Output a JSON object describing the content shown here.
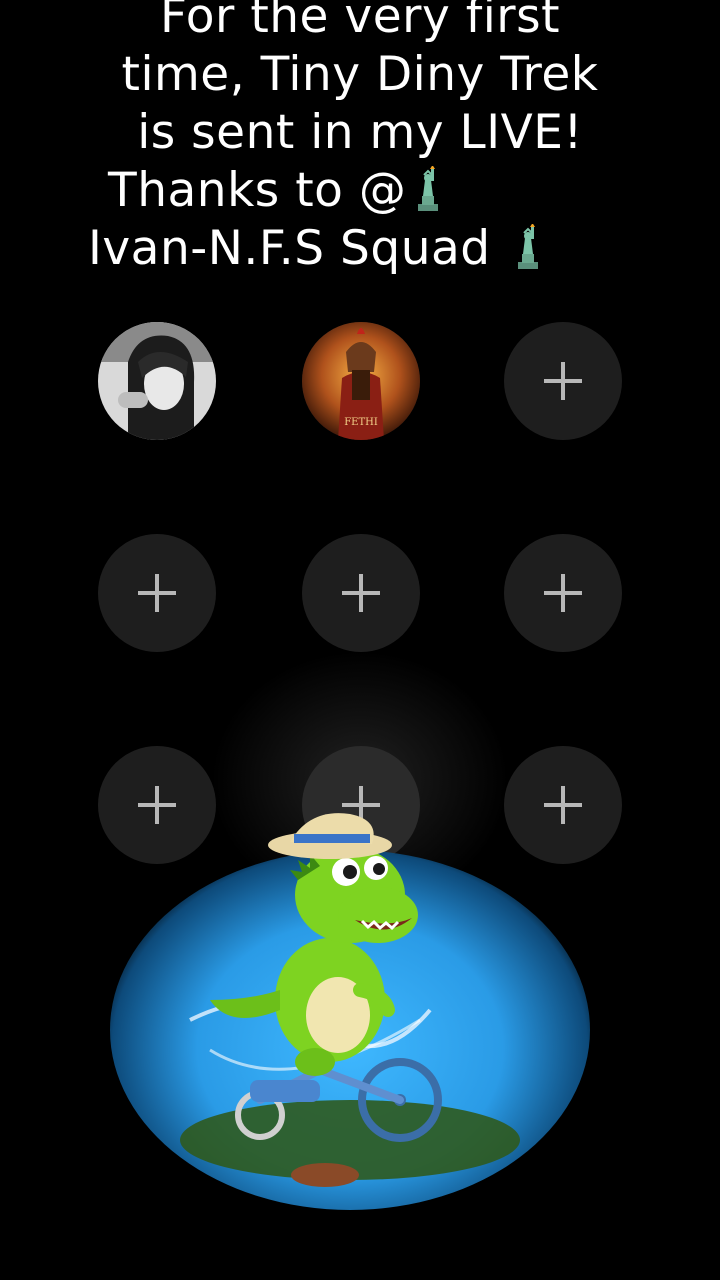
{
  "banner": {
    "line1": "For the very first",
    "line2": "time, Tiny Diny Trek",
    "line3": "is sent in my LIVE!",
    "line4": "Thanks to @",
    "line5": "Ivan-N.F.S Squad"
  },
  "avatars": [
    {
      "label": "FETHI"
    }
  ],
  "slots": {
    "add_icon": "plus-icon",
    "count": 9
  },
  "colors": {
    "background": "#000000",
    "slot_bg": "#1e1e1e",
    "glow": "#3fb8ff",
    "dino": "#7ed321"
  }
}
